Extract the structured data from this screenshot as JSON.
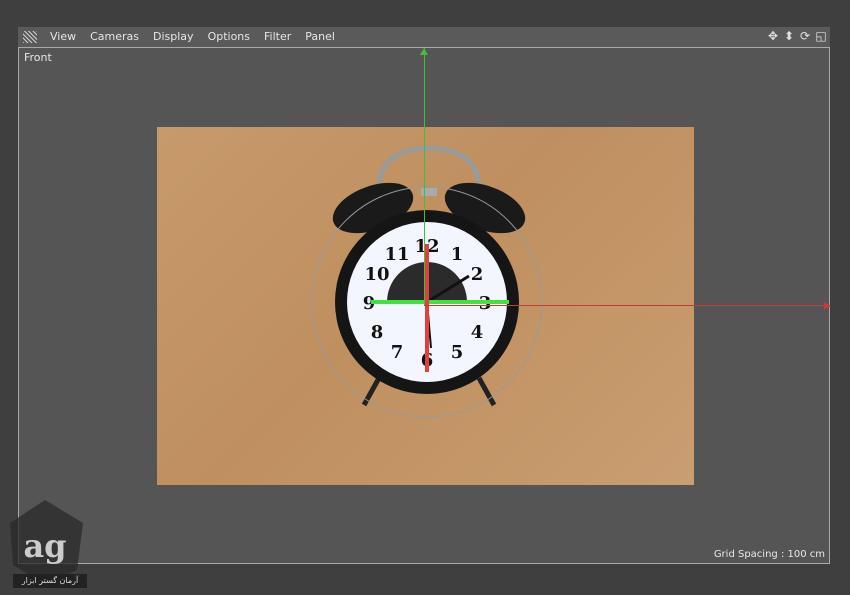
{
  "menu": {
    "items": [
      "View",
      "Cameras",
      "Display",
      "Options",
      "Filter",
      "Panel"
    ]
  },
  "nav_icons": [
    "move-icon",
    "zoom-icon",
    "rotate-icon",
    "maximize-icon"
  ],
  "viewport": {
    "label": "Front",
    "grid_spacing": "Grid Spacing : 100 cm"
  },
  "clock": {
    "numbers": [
      "12",
      "1",
      "2",
      "3",
      "4",
      "5",
      "6",
      "7",
      "8",
      "9",
      "10",
      "11"
    ]
  },
  "watermark": {
    "logo_text": "ag",
    "caption": "آرمان گستر ابزار"
  },
  "colors": {
    "axis_x": "#c63a3a",
    "axis_y": "#3fbf3f",
    "background": "#555555"
  }
}
